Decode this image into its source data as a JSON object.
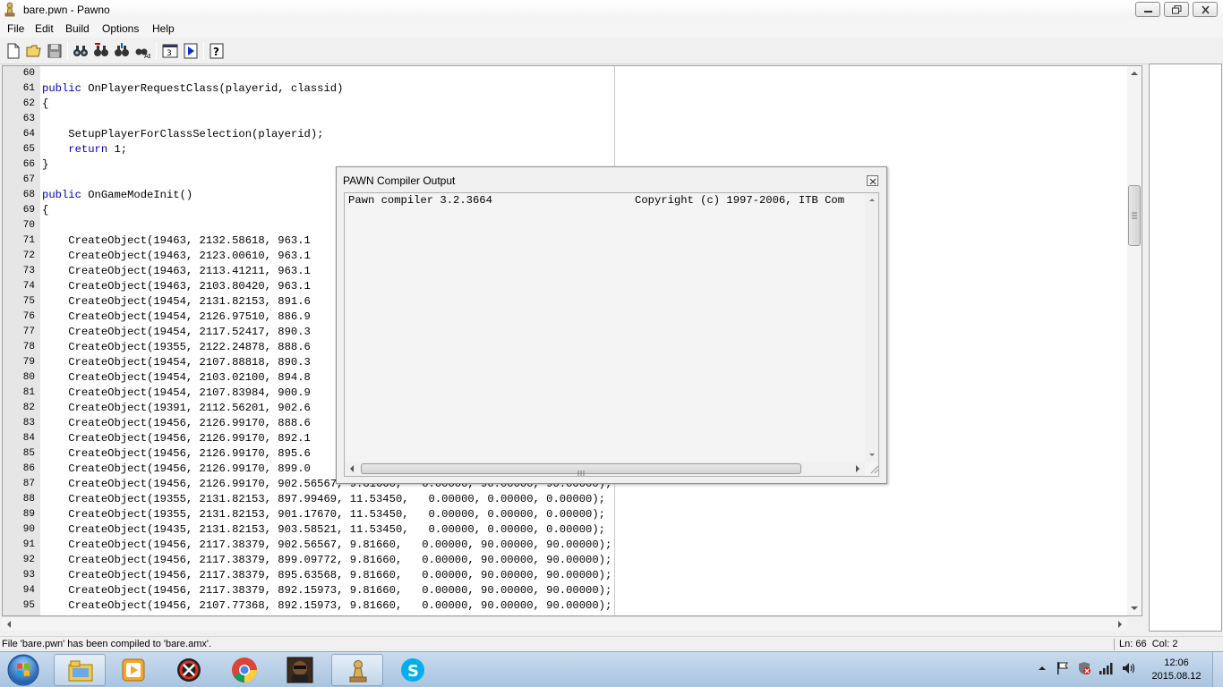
{
  "window": {
    "title": "bare.pwn - Pawno",
    "controls": {
      "minimize_icon": "minimize-icon",
      "maximize_icon": "restore-icon",
      "close_icon": "close-icon"
    }
  },
  "menu": [
    "File",
    "Edit",
    "Build",
    "Options",
    "Help"
  ],
  "toolbar": [
    {
      "name": "new-icon"
    },
    {
      "name": "open-icon"
    },
    {
      "name": "save-icon"
    },
    {
      "name": "find-icon"
    },
    {
      "name": "find-next-icon"
    },
    {
      "name": "replace-icon"
    },
    {
      "name": "replace-all-icon"
    },
    {
      "name": "font-icon"
    },
    {
      "name": "compile-run-icon"
    },
    {
      "name": "help-icon"
    }
  ],
  "editor": {
    "lines": [
      {
        "n": "60",
        "t": ""
      },
      {
        "n": "61",
        "kw": "public",
        "t": " OnPlayerRequestClass(playerid, classid)"
      },
      {
        "n": "62",
        "t": "{"
      },
      {
        "n": "63",
        "t": ""
      },
      {
        "n": "64",
        "t": "    SetupPlayerForClassSelection(playerid);"
      },
      {
        "n": "65",
        "pre": "    ",
        "kw": "return",
        "t": " 1;"
      },
      {
        "n": "66",
        "t": "}"
      },
      {
        "n": "67",
        "t": ""
      },
      {
        "n": "68",
        "kw": "public",
        "t": " OnGameModeInit()"
      },
      {
        "n": "69",
        "t": "{"
      },
      {
        "n": "70",
        "t": ""
      },
      {
        "n": "71",
        "t": "    CreateObject(19463, 2132.58618, 963.1"
      },
      {
        "n": "72",
        "t": "    CreateObject(19463, 2123.00610, 963.1"
      },
      {
        "n": "73",
        "t": "    CreateObject(19463, 2113.41211, 963.1"
      },
      {
        "n": "74",
        "t": "    CreateObject(19463, 2103.80420, 963.1"
      },
      {
        "n": "75",
        "t": "    CreateObject(19454, 2131.82153, 891.6"
      },
      {
        "n": "76",
        "t": "    CreateObject(19454, 2126.97510, 886.9"
      },
      {
        "n": "77",
        "t": "    CreateObject(19454, 2117.52417, 890.3"
      },
      {
        "n": "78",
        "t": "    CreateObject(19355, 2122.24878, 888.6"
      },
      {
        "n": "79",
        "t": "    CreateObject(19454, 2107.88818, 890.3"
      },
      {
        "n": "80",
        "t": "    CreateObject(19454, 2103.02100, 894.8"
      },
      {
        "n": "81",
        "t": "    CreateObject(19454, 2107.83984, 900.9"
      },
      {
        "n": "82",
        "t": "    CreateObject(19391, 2112.56201, 902.6"
      },
      {
        "n": "83",
        "t": "    CreateObject(19456, 2126.99170, 888.6"
      },
      {
        "n": "84",
        "t": "    CreateObject(19456, 2126.99170, 892.1"
      },
      {
        "n": "85",
        "t": "    CreateObject(19456, 2126.99170, 895.6"
      },
      {
        "n": "86",
        "t": "    CreateObject(19456, 2126.99170, 899.0"
      },
      {
        "n": "87",
        "t": "    CreateObject(19456, 2126.99170, 902.56567, 9.81660,   0.00000, 90.00000, 90.00000);"
      },
      {
        "n": "88",
        "t": "    CreateObject(19355, 2131.82153, 897.99469, 11.53450,   0.00000, 0.00000, 0.00000);"
      },
      {
        "n": "89",
        "t": "    CreateObject(19355, 2131.82153, 901.17670, 11.53450,   0.00000, 0.00000, 0.00000);"
      },
      {
        "n": "90",
        "t": "    CreateObject(19435, 2131.82153, 903.58521, 11.53450,   0.00000, 0.00000, 0.00000);"
      },
      {
        "n": "91",
        "t": "    CreateObject(19456, 2117.38379, 902.56567, 9.81660,   0.00000, 90.00000, 90.00000);"
      },
      {
        "n": "92",
        "t": "    CreateObject(19456, 2117.38379, 899.09772, 9.81660,   0.00000, 90.00000, 90.00000);"
      },
      {
        "n": "93",
        "t": "    CreateObject(19456, 2117.38379, 895.63568, 9.81660,   0.00000, 90.00000, 90.00000);"
      },
      {
        "n": "94",
        "t": "    CreateObject(19456, 2117.38379, 892.15973, 9.81660,   0.00000, 90.00000, 90.00000);"
      },
      {
        "n": "95",
        "t": "    CreateObject(19456, 2107.77368, 892.15973, 9.81660,   0.00000, 90.00000, 90.00000);"
      }
    ]
  },
  "dialog": {
    "title": "PAWN Compiler Output",
    "line_left": "Pawn compiler 3.2.3664",
    "line_right": "Copyright (c) 1997-2006, ITB Com",
    "close_icon": "close-icon"
  },
  "status": {
    "message": "File 'bare.pwn' has been compiled to 'bare.amx'.",
    "position": "Ln: 66  Col: 2"
  },
  "taskbar": {
    "apps": [
      {
        "name": "explorer-icon"
      },
      {
        "name": "media-player-icon"
      },
      {
        "name": "gta-sa-icon"
      },
      {
        "name": "chrome-icon"
      },
      {
        "name": "gta-character-icon"
      },
      {
        "name": "pawno-icon"
      },
      {
        "name": "skype-icon"
      }
    ],
    "clock_time": "12:06",
    "clock_date": "2015.08.12"
  },
  "colors": {
    "keyword": "#0000c0",
    "gutter": "#e6e6e6",
    "taskbar": "#b9cfe7"
  }
}
